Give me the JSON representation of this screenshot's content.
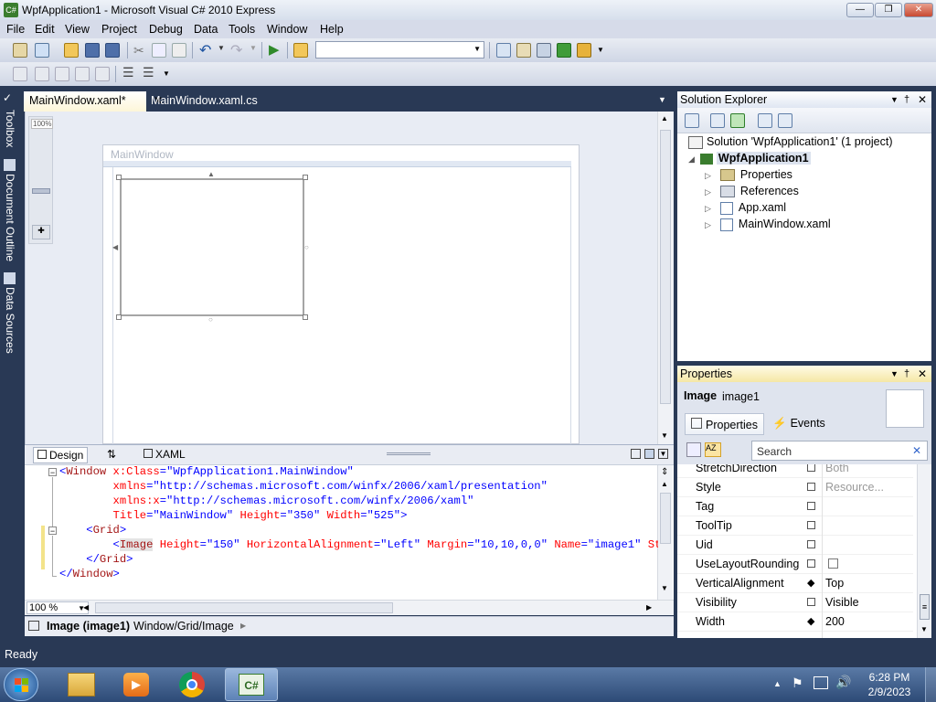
{
  "window": {
    "title": "WpfApplication1 - Microsoft Visual C# 2010 Express"
  },
  "menu": [
    "File",
    "Edit",
    "View",
    "Project",
    "Debug",
    "Data",
    "Tools",
    "Window",
    "Help"
  ],
  "left_tabs": [
    "Toolbox",
    "Document Outline",
    "Data Sources"
  ],
  "doc_tabs": [
    {
      "label": "MainWindow.xaml*",
      "active": true
    },
    {
      "label": "MainWindow.xaml.cs",
      "active": false
    }
  ],
  "designer": {
    "zoom_label": "100%",
    "window_title": "MainWindow"
  },
  "split": {
    "design_tab": "Design",
    "xaml_tab": "XAML"
  },
  "xaml_lines": [
    "<Window x:Class=\"WpfApplication1.MainWindow\"",
    "        xmlns=\"http://schemas.microsoft.com/winfx/2006/xaml/presentation\"",
    "        xmlns:x=\"http://schemas.microsoft.com/winfx/2006/xaml\"",
    "        Title=\"MainWindow\" Height=\"350\" Width=\"525\">",
    "    <Grid>",
    "        <Image Height=\"150\" HorizontalAlignment=\"Left\" Margin=\"10,10,0,0\" Name=\"image1\" Stretc",
    "    </Grid>",
    "</Window>"
  ],
  "zoom_select": "100 %",
  "breadcrumb": {
    "element": "Image (image1)",
    "path": "Window/Grid/Image"
  },
  "solution_explorer": {
    "title": "Solution Explorer",
    "solution": "Solution 'WpfApplication1' (1 project)",
    "project": "WpfApplication1",
    "items": [
      "Properties",
      "References",
      "App.xaml",
      "MainWindow.xaml"
    ]
  },
  "properties_panel": {
    "title": "Properties",
    "type": "Image",
    "name": "image1",
    "tab_properties": "Properties",
    "tab_events": "Events",
    "search_placeholder": "Search",
    "rows": [
      {
        "name": "StretchDirection",
        "value": "Both"
      },
      {
        "name": "Style",
        "value": "Resource..."
      },
      {
        "name": "Tag",
        "value": ""
      },
      {
        "name": "ToolTip",
        "value": ""
      },
      {
        "name": "Uid",
        "value": ""
      },
      {
        "name": "UseLayoutRounding",
        "value": ""
      },
      {
        "name": "VerticalAlignment",
        "value": "Top"
      },
      {
        "name": "Visibility",
        "value": "Visible"
      },
      {
        "name": "Width",
        "value": "200"
      }
    ]
  },
  "status": {
    "text": "Ready"
  },
  "taskbar": {
    "time": "6:28 PM",
    "date": "2/9/2023"
  }
}
